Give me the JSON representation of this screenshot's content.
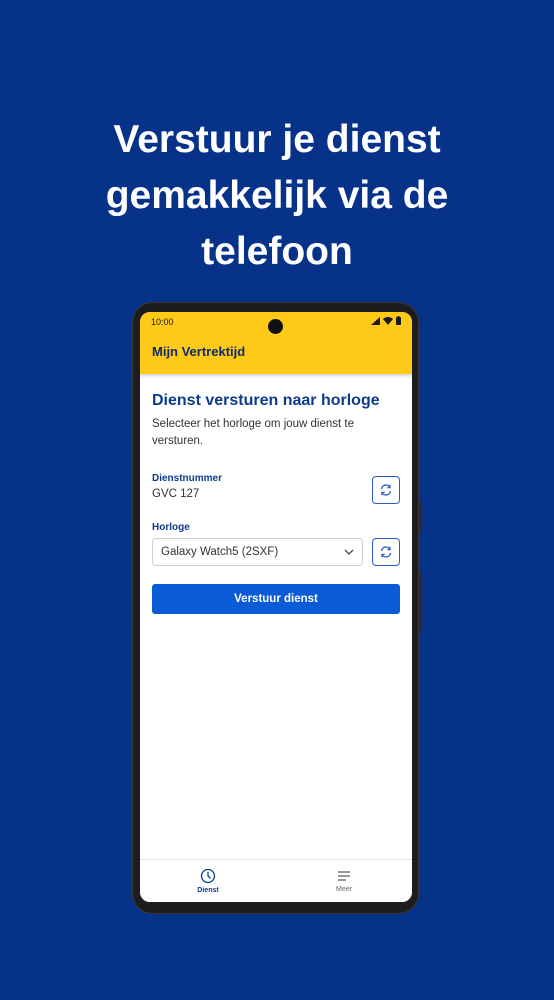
{
  "headline": {
    "line1": "Verstuur je dienst",
    "line2": "gemakkelijk via de",
    "line3": "telefoon"
  },
  "status_bar": {
    "time": "10:00",
    "icons": [
      "signal-icon",
      "wifi-icon",
      "battery-icon"
    ]
  },
  "app_bar": {
    "title": "Mijn Vertrektijd"
  },
  "main": {
    "title": "Dienst versturen naar horloge",
    "description": "Selecteer het horloge om jouw dienst te versturen.",
    "dienstnummer": {
      "label": "Dienstnummer",
      "value": "GVC 127",
      "refresh_icon": "refresh-icon"
    },
    "horloge": {
      "label": "Horloge",
      "selected": "Galaxy Watch5 (2SXF)",
      "dropdown_icon": "chevron-down-icon",
      "refresh_icon": "refresh-icon"
    },
    "submit_label": "Verstuur dienst"
  },
  "bottom_nav": {
    "items": [
      {
        "label": "Dienst",
        "icon": "clock-icon",
        "active": true
      },
      {
        "label": "Meer",
        "icon": "menu-icon",
        "active": false
      }
    ]
  },
  "colors": {
    "background": "#06328a",
    "app_bar": "#ffc917",
    "primary": "#0a5bd6",
    "heading": "#0d3c8c"
  }
}
